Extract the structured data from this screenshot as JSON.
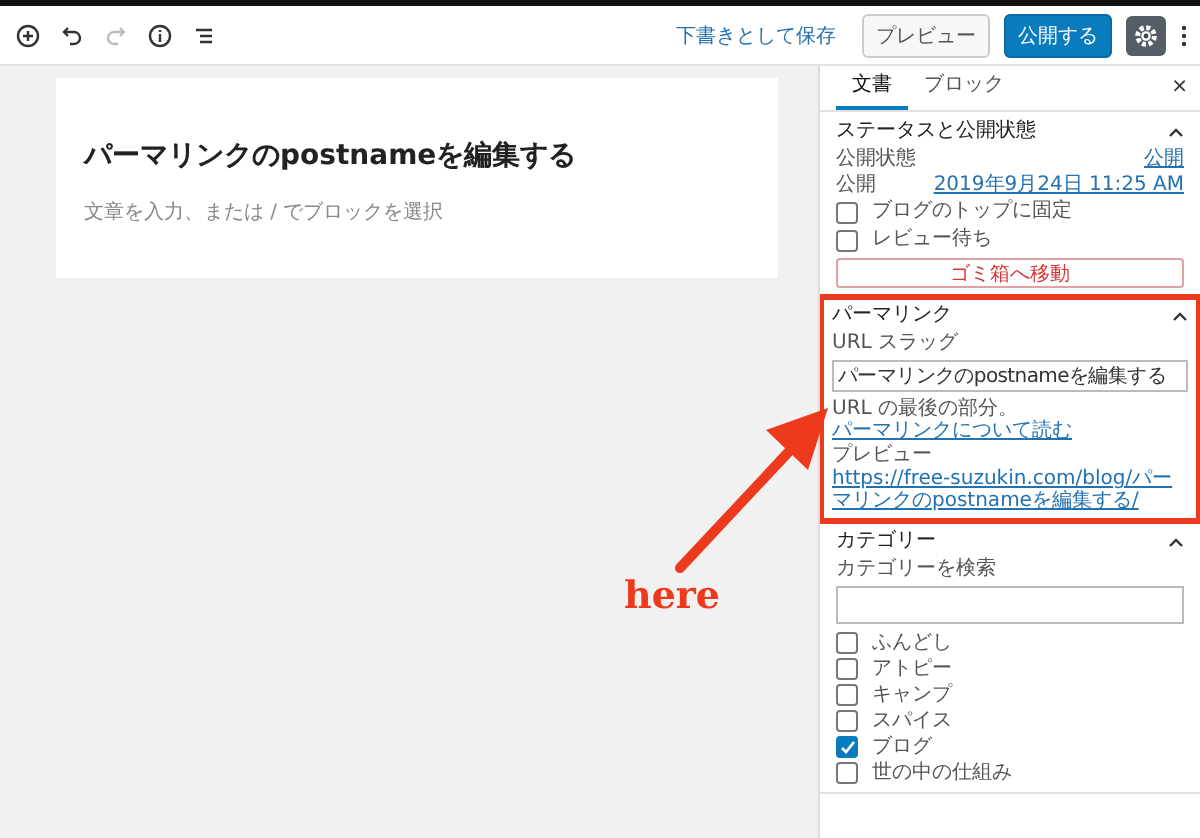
{
  "toolbar": {
    "save_draft": "下書きとして保存",
    "preview": "プレビュー",
    "publish": "公開する"
  },
  "editor": {
    "title": "パーマリンクのpostnameを編集する",
    "placeholder": "文章を入力、または / でブロックを選択"
  },
  "sidebar": {
    "tabs": [
      {
        "label": "文書",
        "selected": true
      },
      {
        "label": "ブロック",
        "selected": false
      }
    ],
    "close": "×",
    "status": {
      "heading": "ステータスと公開状態",
      "expanded": true,
      "rows": [
        {
          "label": "公開状態",
          "value": "公開"
        },
        {
          "label": "公開",
          "value": "2019年9月24日 11:25 AM"
        }
      ],
      "options": [
        {
          "label": "ブログのトップに固定",
          "checked": false
        },
        {
          "label": "レビュー待ち",
          "checked": false
        }
      ],
      "trash": "ゴミ箱へ移動"
    },
    "permalink": {
      "heading": "パーマリンク",
      "expanded": true,
      "slug_label": "URL スラッグ",
      "slug": "パーマリンクのpostnameを編集する",
      "help": "URL の最後の部分。",
      "help_link": "パーマリンクについて読む",
      "preview_label": "プレビュー",
      "preview_url": "https://free-suzukin.com/blog/パーマリンクのpostnameを編集する/"
    },
    "categories": {
      "heading": "カテゴリー",
      "expanded": true,
      "search_label": "カテゴリーを検索",
      "items": [
        {
          "label": "ふんどし",
          "checked": false
        },
        {
          "label": "アトピー",
          "checked": false
        },
        {
          "label": "キャンプ",
          "checked": false
        },
        {
          "label": "スパイス",
          "checked": false
        },
        {
          "label": "ブログ",
          "checked": true
        },
        {
          "label": "世の中の仕組み",
          "checked": false
        }
      ]
    }
  },
  "annotation": {
    "label": "here"
  }
}
